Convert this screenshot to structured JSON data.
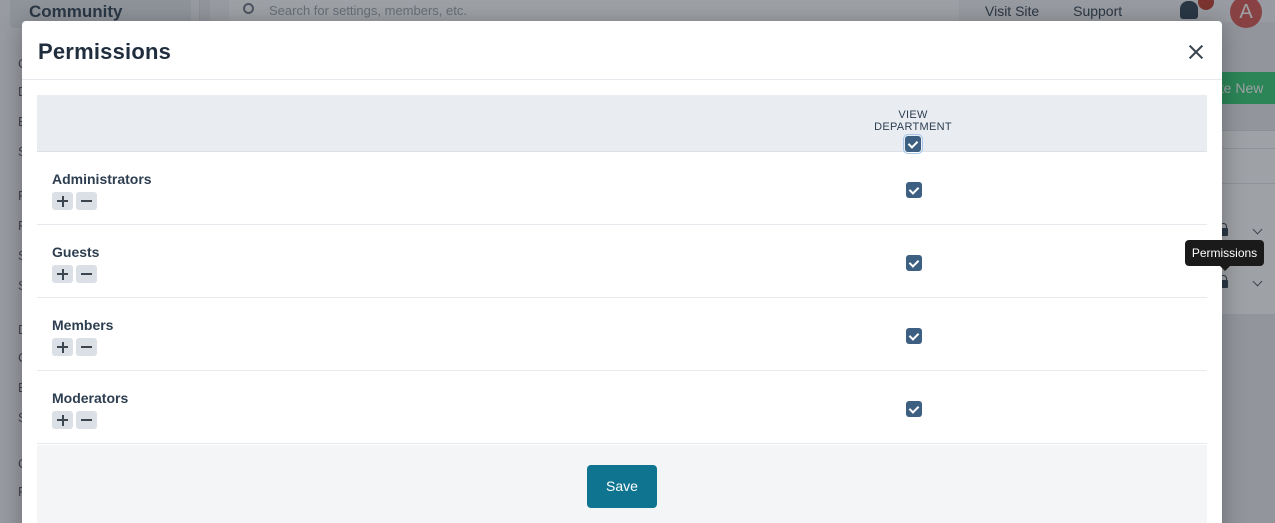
{
  "background": {
    "community_label": "Community",
    "search_placeholder": "Search for settings, members, etc.",
    "visit_site": "Visit Site",
    "support": "Support",
    "avatar_letter": "A",
    "create_new": "ate New",
    "side_letters": [
      "C",
      "D",
      "E",
      "S",
      "F",
      "F",
      "S",
      "S",
      "D",
      "C",
      "E",
      "S",
      "C",
      "F"
    ]
  },
  "modal": {
    "title": "Permissions",
    "column_header": "VIEW DEPARTMENT",
    "rows": [
      {
        "name": "Administrators",
        "checked": true
      },
      {
        "name": "Guests",
        "checked": true
      },
      {
        "name": "Members",
        "checked": true
      },
      {
        "name": "Moderators",
        "checked": true
      }
    ],
    "save_label": "Save"
  },
  "tooltip": {
    "text": "Permissions"
  },
  "colors": {
    "checkbox": "#3d5f82",
    "save_button": "#0e7490",
    "header_bg": "#e9edf2"
  }
}
